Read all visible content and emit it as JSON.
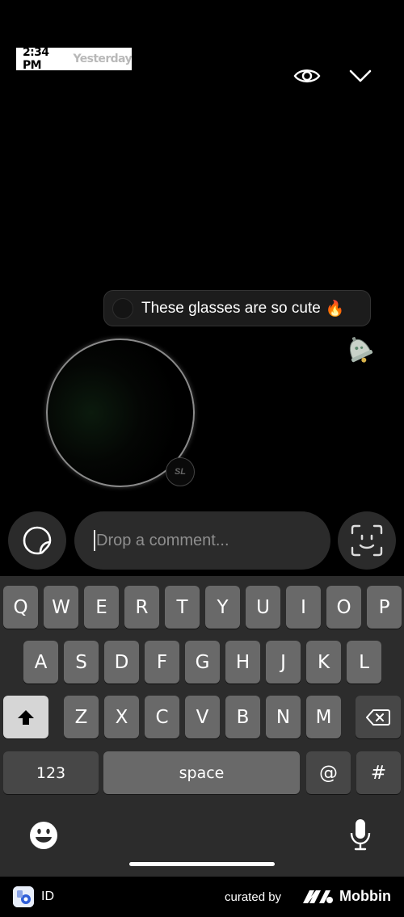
{
  "story": {
    "time": "2:34 PM",
    "day": "Yesterday"
  },
  "top_icons": [
    "eye-icon",
    "chevron-down-icon"
  ],
  "comment": {
    "text": "These glasses are so cute",
    "emoji": "🔥"
  },
  "compose": {
    "placeholder": "Drop a comment..."
  },
  "keyboard": {
    "row1": [
      "Q",
      "W",
      "E",
      "R",
      "T",
      "Y",
      "U",
      "I",
      "O",
      "P"
    ],
    "row2": [
      "A",
      "S",
      "D",
      "F",
      "G",
      "H",
      "J",
      "K",
      "L"
    ],
    "row3": [
      "Z",
      "X",
      "C",
      "V",
      "B",
      "N",
      "M"
    ],
    "numbers_label": "123",
    "space_label": "space",
    "at_label": "@",
    "hash_label": "#"
  },
  "footer": {
    "app_label": "ID",
    "curated_by": "curated by",
    "brand": "Mobbin"
  },
  "colors": {
    "background": "#000000",
    "input_bg": "#2b2b2b",
    "keyboard_bg": "#2c2c2c",
    "key_bg": "#696969"
  }
}
